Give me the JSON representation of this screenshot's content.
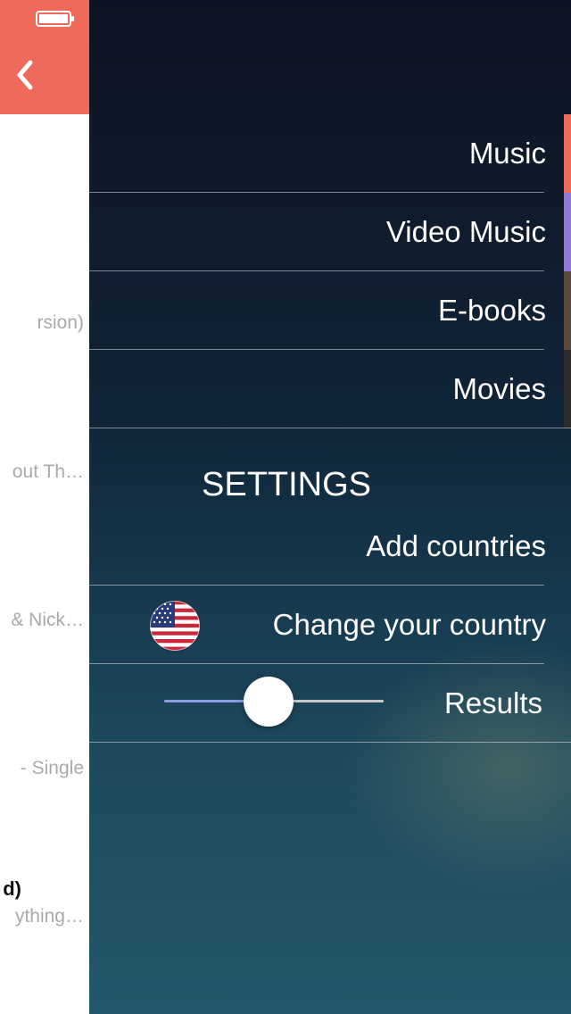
{
  "left_panel": {
    "rows": [
      {
        "text": "rsion)",
        "style": "light"
      },
      {
        "text": "out Th…",
        "style": "light"
      },
      {
        "text": "& Nick…",
        "style": "light"
      },
      {
        "text": "- Single",
        "style": "light"
      },
      {
        "text": "d)",
        "style": "dark"
      },
      {
        "text": "ything…",
        "style": "light"
      }
    ]
  },
  "menu": {
    "items": [
      {
        "label": "Music",
        "accent": "#ee6a5a"
      },
      {
        "label": "Video Music",
        "accent": "#8f78d4"
      },
      {
        "label": "E-books",
        "accent": "#5b4a3e"
      },
      {
        "label": "Movies",
        "accent": "#2d2c2b"
      }
    ]
  },
  "settings": {
    "title": "SETTINGS",
    "add_countries": "Add countries",
    "change_country": "Change your country",
    "results": "Results",
    "results_slider_value": 0.35
  },
  "colors": {
    "header": "#ee6a5a",
    "slider_fill": "#8a9cdf"
  }
}
